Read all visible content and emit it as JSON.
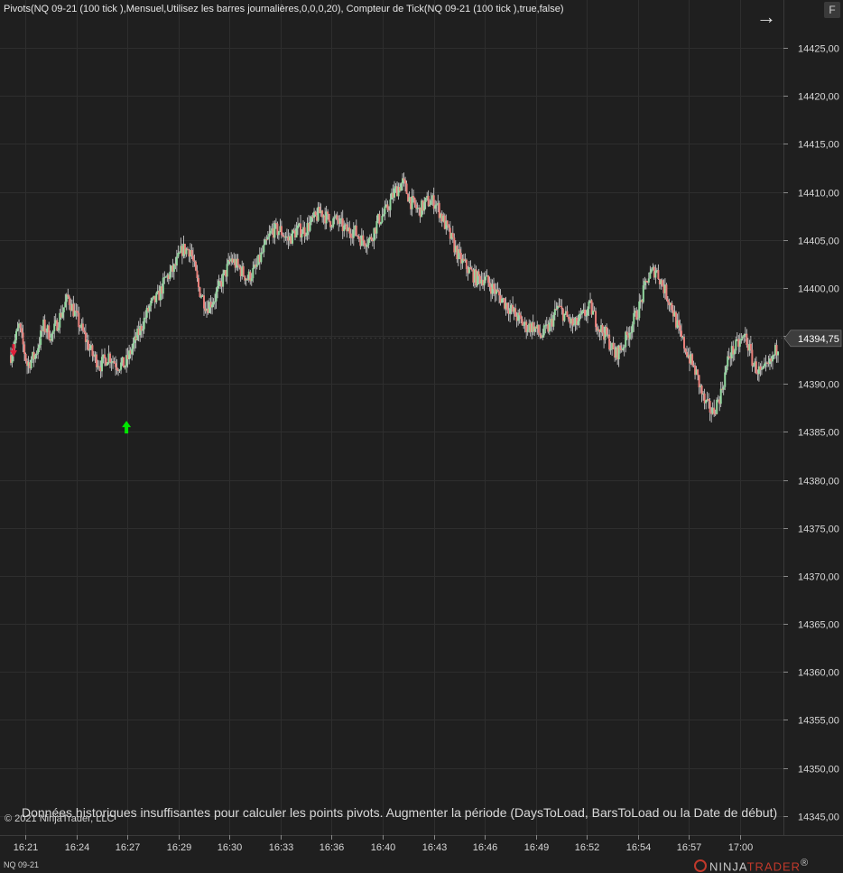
{
  "header": {
    "indicator_label": "Pivots(NQ 09-21 (100 tick ),Mensuel,Utilisez les barres journalières,0,0,0,20), Compteur de Tick(NQ 09-21 (100 tick ),true,false)"
  },
  "toolbar": {
    "nav_icon": "arrow-right-icon",
    "f_label": "F"
  },
  "footer": {
    "copyright": "© 2021 NinjaTrader, LLC",
    "message": "Données historiques insuffisantes pour calculer les points pivots. Augmenter la période (DaysToLoad, BarsToLoad ou la Date de début)",
    "symbol": "NQ 09-21",
    "brand_prefix": "NINJA",
    "brand_suffix": "TRADER",
    "brand_mark": "®"
  },
  "colors": {
    "up": "#93d9a0",
    "down": "#e87f7a",
    "wick": "#d8d8d8",
    "grid": "#2e2e2e",
    "marker_buy": "#00e600",
    "marker_sell": "#e0203a",
    "background": "#1f1f1f"
  },
  "chart_data": {
    "type": "candlestick",
    "title": "",
    "ylim": [
      14343,
      14430
    ],
    "y_ticks": [
      14345,
      14350,
      14355,
      14360,
      14365,
      14370,
      14375,
      14380,
      14385,
      14390,
      14395,
      14400,
      14405,
      14410,
      14415,
      14420,
      14425
    ],
    "y_tick_labels": [
      "14345,00",
      "14350,00",
      "14355,00",
      "14360,00",
      "14365,00",
      "14370,00",
      "14375,00",
      "14380,00",
      "14385,00",
      "14390,00",
      "14395,00",
      "14400,00",
      "14405,00",
      "14410,00",
      "14415,00",
      "14420,00",
      "14425,00"
    ],
    "x_tick_labels": [
      "16:21",
      "16:24",
      "16:27",
      "16:29",
      "16:30",
      "16:33",
      "16:36",
      "16:40",
      "16:43",
      "16:46",
      "16:49",
      "16:52",
      "16:54",
      "16:57",
      "17:00"
    ],
    "last_price": 14394.75,
    "last_price_label": "14394,75",
    "price_path": [
      [
        0,
        14393
      ],
      [
        6,
        14396
      ],
      [
        12,
        14392
      ],
      [
        18,
        14393
      ],
      [
        24,
        14396
      ],
      [
        30,
        14395
      ],
      [
        36,
        14397
      ],
      [
        42,
        14399
      ],
      [
        48,
        14397
      ],
      [
        54,
        14395
      ],
      [
        60,
        14393
      ],
      [
        66,
        14392
      ],
      [
        72,
        14393
      ],
      [
        78,
        14392
      ],
      [
        84,
        14392
      ],
      [
        90,
        14394
      ],
      [
        96,
        14396
      ],
      [
        102,
        14398
      ],
      [
        108,
        14399
      ],
      [
        114,
        14401
      ],
      [
        120,
        14402
      ],
      [
        126,
        14404
      ],
      [
        132,
        14404
      ],
      [
        138,
        14400
      ],
      [
        144,
        14398
      ],
      [
        150,
        14399
      ],
      [
        156,
        14401
      ],
      [
        162,
        14403
      ],
      [
        168,
        14402
      ],
      [
        174,
        14401
      ],
      [
        180,
        14402
      ],
      [
        186,
        14404
      ],
      [
        192,
        14406
      ],
      [
        198,
        14406
      ],
      [
        204,
        14405
      ],
      [
        210,
        14406
      ],
      [
        216,
        14406
      ],
      [
        222,
        14407
      ],
      [
        228,
        14408
      ],
      [
        234,
        14407
      ],
      [
        240,
        14407
      ],
      [
        246,
        14406
      ],
      [
        252,
        14406
      ],
      [
        258,
        14405
      ],
      [
        264,
        14405
      ],
      [
        270,
        14407
      ],
      [
        276,
        14408
      ],
      [
        282,
        14410
      ],
      [
        288,
        14411
      ],
      [
        294,
        14409
      ],
      [
        300,
        14408
      ],
      [
        306,
        14409
      ],
      [
        312,
        14409
      ],
      [
        318,
        14407
      ],
      [
        324,
        14405
      ],
      [
        330,
        14403
      ],
      [
        336,
        14402
      ],
      [
        342,
        14401
      ],
      [
        348,
        14401
      ],
      [
        354,
        14400
      ],
      [
        360,
        14399
      ],
      [
        366,
        14398
      ],
      [
        372,
        14397
      ],
      [
        378,
        14396
      ],
      [
        384,
        14396
      ],
      [
        390,
        14395
      ],
      [
        396,
        14396
      ],
      [
        402,
        14398
      ],
      [
        408,
        14397
      ],
      [
        414,
        14396
      ],
      [
        420,
        14397
      ],
      [
        426,
        14398
      ],
      [
        432,
        14396
      ],
      [
        438,
        14395
      ],
      [
        444,
        14393
      ],
      [
        450,
        14394
      ],
      [
        456,
        14396
      ],
      [
        462,
        14398
      ],
      [
        468,
        14401
      ],
      [
        474,
        14402
      ],
      [
        480,
        14400
      ],
      [
        486,
        14398
      ],
      [
        492,
        14395
      ],
      [
        498,
        14393
      ],
      [
        504,
        14391
      ],
      [
        510,
        14388
      ],
      [
        516,
        14387
      ],
      [
        522,
        14389
      ],
      [
        528,
        14393
      ],
      [
        534,
        14394
      ],
      [
        540,
        14395
      ],
      [
        546,
        14392
      ],
      [
        552,
        14391
      ],
      [
        558,
        14392
      ],
      [
        564,
        14394
      ]
    ],
    "markers": [
      {
        "type": "sell",
        "x_index": 2,
        "price": 14393.5
      },
      {
        "type": "buy",
        "x_index": 85,
        "price": 14385.5
      }
    ]
  }
}
